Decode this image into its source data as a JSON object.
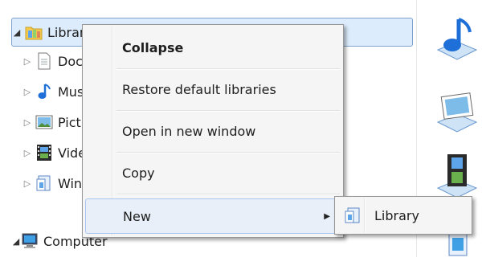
{
  "tree": {
    "libraries": "Libraries",
    "items": [
      {
        "label": "Documents",
        "icon": "documents-library-icon"
      },
      {
        "label": "Music",
        "icon": "music-library-icon"
      },
      {
        "label": "Pictures",
        "icon": "pictures-library-icon"
      },
      {
        "label": "Videos",
        "icon": "videos-library-icon"
      },
      {
        "label": "WinLibrary",
        "icon": "custom-library-icon"
      }
    ],
    "computer": "Computer"
  },
  "context_menu": {
    "items": [
      {
        "label": "Collapse",
        "bold": true
      },
      {
        "label": "Restore default libraries"
      },
      {
        "label": "Open in new window"
      },
      {
        "label": "Copy"
      },
      {
        "label": "New",
        "has_submenu": true
      }
    ]
  },
  "submenu": {
    "items": [
      {
        "label": "Library",
        "icon": "library-icon"
      }
    ]
  },
  "colors": {
    "selection_bg": "#dcecfc",
    "selection_border": "#7da2ce",
    "menu_bg": "#f5f5f5",
    "menu_border": "#979797"
  }
}
